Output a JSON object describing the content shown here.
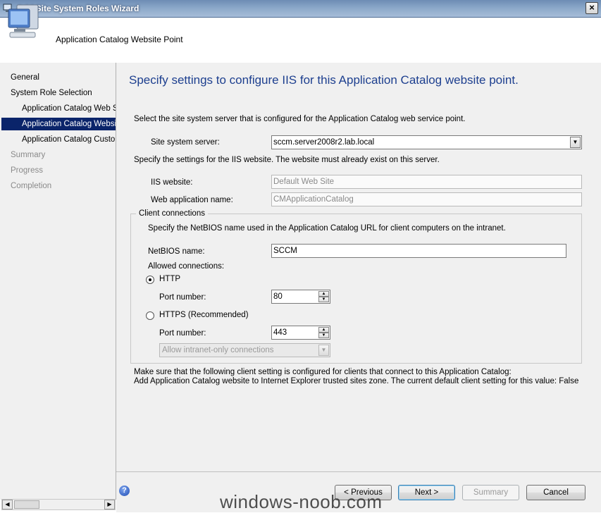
{
  "window": {
    "title": "Add Site System Roles Wizard",
    "close_label": "×"
  },
  "header": {
    "title": "Application Catalog Website Point"
  },
  "nav": {
    "items": [
      {
        "label": "General",
        "state": "normal"
      },
      {
        "label": "System Role Selection",
        "state": "normal"
      },
      {
        "label": "Application Catalog Web Service Point",
        "state": "normal"
      },
      {
        "label": "Application Catalog Website Point",
        "state": "selected"
      },
      {
        "label": "Application Catalog Customizations",
        "state": "normal"
      },
      {
        "label": "Summary",
        "state": "disabled"
      },
      {
        "label": "Progress",
        "state": "disabled"
      },
      {
        "label": "Completion",
        "state": "disabled"
      }
    ]
  },
  "main": {
    "heading": "Specify settings to configure IIS for this Application Catalog website point.",
    "select_server_text": "Select the site system server that is configured for the Application Catalog web service point.",
    "site_system_server_label": "Site system server:",
    "site_system_server_value": "sccm.server2008r2.lab.local",
    "iis_settings_text": "Specify the settings for the IIS website. The website must already exist on this server.",
    "iis_website_label": "IIS website:",
    "iis_website_value": "Default Web Site",
    "web_app_name_label": "Web application name:",
    "web_app_name_value": "CMApplicationCatalog",
    "client_connections": {
      "title": "Client connections",
      "netbios_text": "Specify the NetBIOS name used in the Application Catalog URL for client computers on the intranet.",
      "netbios_label": "NetBIOS name:",
      "netbios_value": "SCCM",
      "allowed_label": "Allowed connections:",
      "http_label": "HTTP",
      "http_selected": true,
      "http_port_label": "Port number:",
      "http_port_value": "80",
      "https_label": "HTTPS (Recommended)",
      "https_selected": false,
      "https_port_label": "Port number:",
      "https_port_value": "443",
      "https_option_value": "Allow intranet-only connections"
    },
    "note_line1": "Make sure that the following client setting is configured for clients that connect to this Application Catalog:",
    "note_line2": "Add Application Catalog website to Internet Explorer trusted sites zone. The current default client setting for this value: False"
  },
  "footer": {
    "help_label": "?",
    "previous_label": "< Previous",
    "next_label": "Next >",
    "summary_label": "Summary",
    "cancel_label": "Cancel"
  },
  "watermark": "windows-noob.com",
  "colors": {
    "heading": "#1d3f8f",
    "nav_selected": "#0a246a",
    "titlebar": "#8aa7c8"
  }
}
